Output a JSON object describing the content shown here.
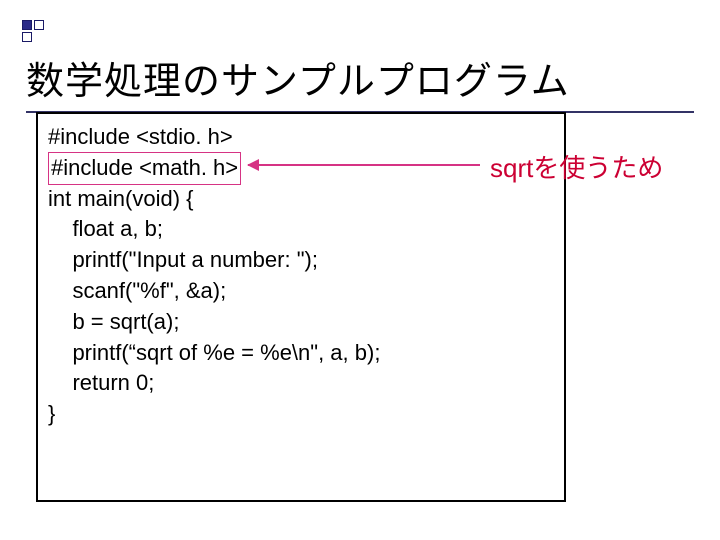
{
  "title": "数学処理のサンプルプログラム",
  "code": {
    "line1": "#include <stdio. h>",
    "line2": "#include <math. h>",
    "blank": "",
    "line3": "int main(void) {",
    "line4": "    float a, b;",
    "line5": "    printf(\"Input a number: \");",
    "line6": "    scanf(\"%f\", &a);",
    "line7": "    b = sqrt(a);",
    "line8": "    printf(“sqrt of %e = %e\\n\", a, b);",
    "line9": "    return 0;",
    "line10": "}"
  },
  "annotation": "sqrtを使うため"
}
